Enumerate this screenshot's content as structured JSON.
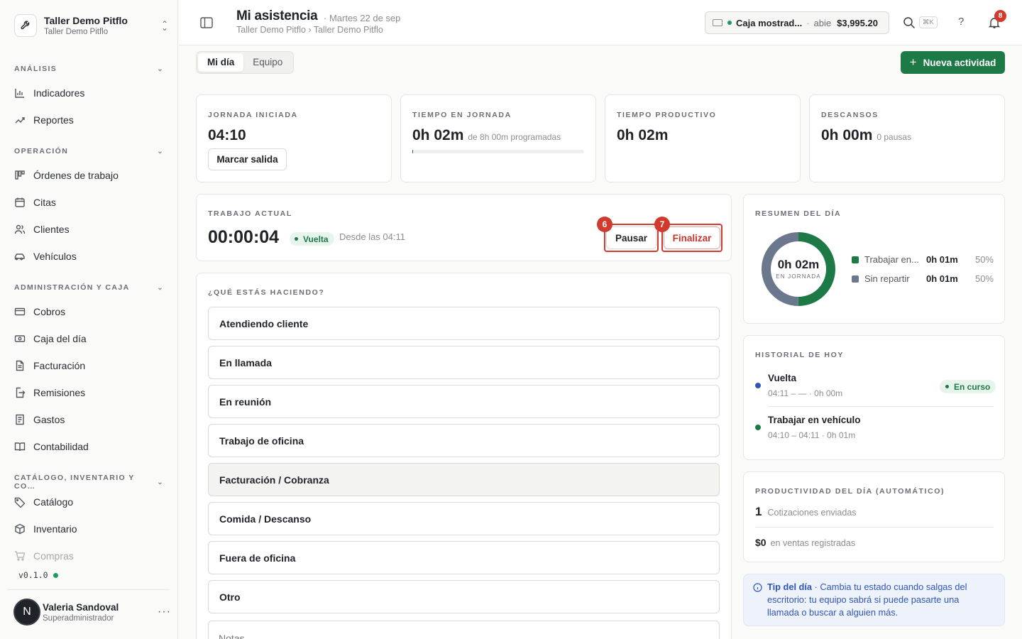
{
  "org": {
    "name": "Taller Demo Pitflo",
    "subtitle": "Taller Demo Pitflo"
  },
  "sidebar": {
    "sections": [
      {
        "label": "ANÁLISIS",
        "items": [
          {
            "label": "Indicadores",
            "icon": "bar-chart-icon"
          },
          {
            "label": "Reportes",
            "icon": "trend-icon"
          }
        ]
      },
      {
        "label": "OPERACIÓN",
        "items": [
          {
            "label": "Órdenes de trabajo",
            "icon": "kanban-icon"
          },
          {
            "label": "Citas",
            "icon": "calendar-icon"
          },
          {
            "label": "Clientes",
            "icon": "users-icon"
          },
          {
            "label": "Vehículos",
            "icon": "car-icon"
          }
        ]
      },
      {
        "label": "ADMINISTRACIÓN Y CAJA",
        "items": [
          {
            "label": "Cobros",
            "icon": "card-icon"
          },
          {
            "label": "Caja del día",
            "icon": "cash-icon"
          },
          {
            "label": "Facturación",
            "icon": "document-icon"
          },
          {
            "label": "Remisiones",
            "icon": "export-icon"
          },
          {
            "label": "Gastos",
            "icon": "receipt-icon"
          },
          {
            "label": "Contabilidad",
            "icon": "book-icon"
          }
        ]
      },
      {
        "label": "CATÁLOGO, INVENTARIO Y CO…",
        "items": [
          {
            "label": "Catálogo",
            "icon": "tag-icon"
          },
          {
            "label": "Inventario",
            "icon": "box-icon"
          },
          {
            "label": "Compras",
            "icon": "cart-icon"
          }
        ]
      }
    ],
    "version": "v0.1.0",
    "user": {
      "initial": "N",
      "name": "Valeria Sandoval",
      "role": "Superadministrador",
      "more": "···"
    }
  },
  "header": {
    "title": "Mi asistencia",
    "date": "· Martes 22 de sep",
    "breadcrumb": "Taller Demo Pitflo › Taller Demo Pitflo",
    "cashbox": {
      "name": "Caja mostrad...",
      "sep": "·",
      "state": "abie",
      "amount": "$3,995.20"
    },
    "search_shortcut": "⌘K",
    "help": "?",
    "notifications": "8"
  },
  "tabs": [
    "Mi día",
    "Equipo"
  ],
  "cta_label": "Nueva actividad",
  "stats": {
    "jornada": {
      "label": "JORNADA INICIADA",
      "value": "04:10",
      "button": "Marcar salida"
    },
    "tiempo": {
      "label": "TIEMPO EN JORNADA",
      "value": "0h 02m",
      "sub": "de 8h 00m programadas",
      "progress": 0.004
    },
    "productivo": {
      "label": "TIEMPO PRODUCTIVO",
      "value": "0h 02m"
    },
    "descansos": {
      "label": "DESCANSOS",
      "value": "0h 00m",
      "sub": "0 pausas"
    }
  },
  "current_work": {
    "label": "TRABAJO ACTUAL",
    "timer": "00:00:04",
    "status": "Vuelta",
    "since": "Desde las 04:11",
    "pause_label": "Pausar",
    "finish_label": "Finalizar",
    "pause_marker": "6",
    "finish_marker": "7"
  },
  "activity": {
    "question": "¿QUÉ ESTÁS HACIENDO?",
    "options": [
      "Atendiendo cliente",
      "En llamada",
      "En reunión",
      "Trabajo de oficina",
      "Facturación / Cobranza",
      "Comida / Descanso",
      "Fuera de oficina",
      "Otro"
    ],
    "selected": "Facturación / Cobranza",
    "notes_placeholder": "Notas"
  },
  "summary": {
    "label": "RESUMEN DEL DÍA",
    "center_value": "0h 02m",
    "center_label": "EN JORNADA",
    "segments": [
      {
        "label": "Trabajar en...",
        "value": "0h 01m",
        "pct": "50%",
        "fraction": 0.5,
        "color": "#1d7a46"
      },
      {
        "label": "Sin repartir",
        "value": "0h 01m",
        "pct": "50%",
        "fraction": 0.5,
        "color": "#6b778c"
      }
    ]
  },
  "history": {
    "label": "HISTORIAL DE HOY",
    "items": [
      {
        "title": "Vuelta",
        "meta": "04:11 – — · 0h 00m",
        "badge": "En curso",
        "color": "#2f56b8"
      },
      {
        "title": "Trabajar en vehículo",
        "meta": "04:10 – 04:11 · 0h 01m",
        "color": "#1d7a46"
      }
    ]
  },
  "productivity": {
    "label": "PRODUCTIVIDAD DEL DÍA (AUTOMÁTICO)",
    "quotes_value": "1",
    "quotes_label": "Cotizaciones enviadas",
    "sales_value": "$0",
    "sales_label": "en ventas registradas"
  },
  "tip": {
    "title": "Tip del día",
    "text": " · Cambia tu estado cuando salgas del escritorio: tu equipo sabrá si puede pasarte una llamada o buscar a alguien más."
  }
}
